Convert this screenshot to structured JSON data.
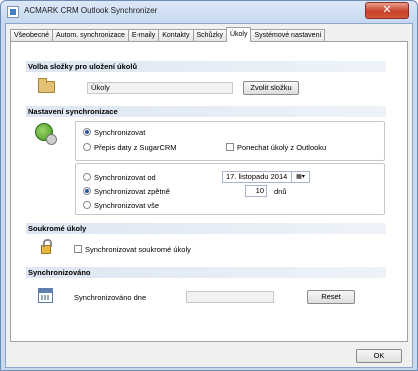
{
  "window": {
    "title": "ACMARK CRM Outlook Synchronizer",
    "close_glyph": "✕"
  },
  "tabs": [
    {
      "label": "Všeobecné"
    },
    {
      "label": "Autom. synchronizace"
    },
    {
      "label": "E-maily"
    },
    {
      "label": "Kontakty"
    },
    {
      "label": "Schůzky"
    },
    {
      "label": "Úkoly",
      "active": true
    },
    {
      "label": "Systémové nastavení"
    }
  ],
  "folder_section": {
    "header": "Volba složky pro uložení úkolů",
    "folder_value": "Úkoly",
    "choose_button": "Zvolit složku"
  },
  "sync_section": {
    "header": "Nastavení synchronizace",
    "radio_sync": "Synchronizovat",
    "radio_overwrite": "Přepis daty z SugarCRM",
    "checkbox_keep": "Ponechat úkoly z Outlooku",
    "radio_from": "Synchronizovat od",
    "date_value": "17. listopadu  2014",
    "date_dropdown_glyph": "▦▾",
    "radio_back": "Synchronizovat zpětně",
    "days_value": "10",
    "days_unit": "dnů",
    "radio_all": "Synchronizovat vše",
    "selected_main": "Synchronizovat",
    "selected_range": "Synchronizovat zpětně"
  },
  "private_section": {
    "header": "Soukromé úkoly",
    "checkbox_private": "Synchronizovat soukromé úkoly"
  },
  "synced_section": {
    "header": "Synchronizováno",
    "label_date": "Synchronizováno dne",
    "date_value": "",
    "reset_button": "Reset"
  },
  "footer": {
    "ok_button": "OK"
  }
}
